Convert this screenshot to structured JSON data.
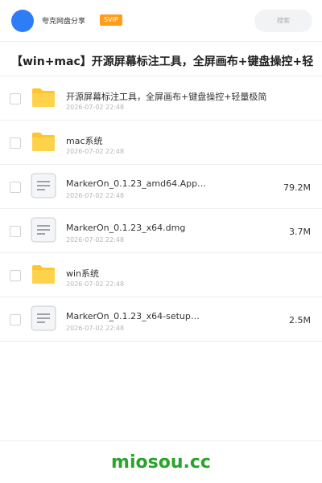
{
  "header": {
    "brand": "夸克网盘分享",
    "vip_badge": "SVIP",
    "search_placeholder": "搜索"
  },
  "share_title": "【win+mac】开源屏幕标注工具，全屏画布+键盘操控+轻",
  "files": [
    {
      "type": "folder",
      "name": "开源屏幕标注工具，全屏画布+键盘操控+轻量极简",
      "date": "2026-07-02 22:48",
      "size": ""
    },
    {
      "type": "folder",
      "name": "mac系统",
      "date": "2026-07-02 22:48",
      "size": ""
    },
    {
      "type": "file",
      "name": "MarkerOn_0.1.23_amd64.App…",
      "date": "2026-07-02 22:48",
      "size": "79.2M"
    },
    {
      "type": "file",
      "name": "MarkerOn_0.1.23_x64.dmg",
      "date": "2026-07-02 22:48",
      "size": "3.7M"
    },
    {
      "type": "folder",
      "name": "win系统",
      "date": "2026-07-02 22:48",
      "size": ""
    },
    {
      "type": "file",
      "name": "MarkerOn_0.1.23_x64-setup…",
      "date": "2026-07-02 22:48",
      "size": "2.5M"
    }
  ],
  "footer": {
    "site": "miosou.cc"
  },
  "colors": {
    "accent": "#2f7df6",
    "vip": "#ff9c1a",
    "folder": "#ffc52e",
    "site": "#27a52a"
  }
}
